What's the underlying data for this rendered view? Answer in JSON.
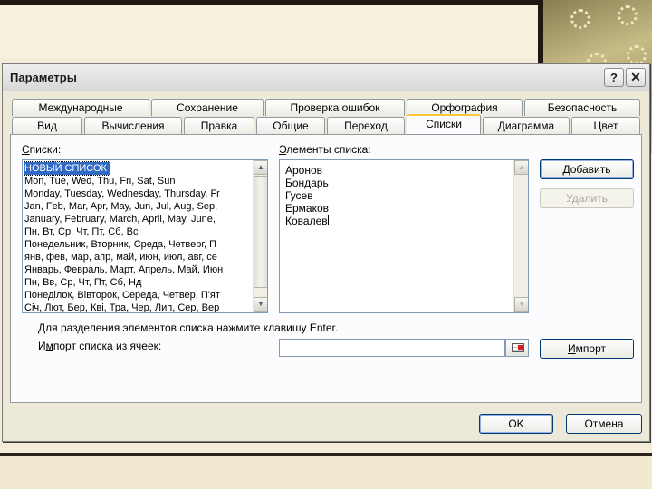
{
  "window": {
    "title": "Параметры",
    "help_glyph": "?",
    "close_glyph": "✕"
  },
  "tabs_row1": [
    "Международные",
    "Сохранение",
    "Проверка ошибок",
    "Орфография",
    "Безопасность"
  ],
  "tabs_row2": [
    "Вид",
    "Вычисления",
    "Правка",
    "Общие",
    "Переход",
    "Списки",
    "Диаграмма",
    "Цвет"
  ],
  "active_tab": "Списки",
  "lists": {
    "label_first": "С",
    "label_rest": "писки:",
    "items": [
      "НОВЫЙ СПИСОК",
      "Mon, Tue, Wed, Thu, Fri, Sat, Sun",
      "Monday, Tuesday, Wednesday, Thursday, Fr",
      "Jan, Feb, Mar, Apr, May, Jun, Jul, Aug, Sep,",
      "January, February, March, April, May, June,",
      "Пн, Вт, Ср, Чт, Пт, Сб, Вс",
      "Понедельник, Вторник, Среда, Четверг, П",
      "янв, фев, мар, апр, май, июн, июл, авг, се",
      "Январь, Февраль, Март, Апрель, Май, Июн",
      "Пн, Вв, Ср, Чт, Пт, Сб, Нд",
      "Понеділок, Вівторок, Середа, Четвер, П'ят",
      "Січ, Лют, Бер, Кві, Тра, Чер, Лип, Сер, Вер"
    ]
  },
  "elements": {
    "label_first": "Э",
    "label_rest": "лементы списка:",
    "items": [
      "Аронов",
      "Бондарь",
      "Гусев",
      "Ермаков",
      "Ковалев"
    ]
  },
  "buttons": {
    "add_first": "Д",
    "add_rest": "обавить",
    "delete": "Удалить",
    "import_first": "И",
    "import_rest": "мпорт",
    "ok": "OK",
    "cancel": "Отмена"
  },
  "hint_text": "Для разделения элементов списка нажмите клавишу Enter.",
  "import_label_pre": "И",
  "import_label_under": "м",
  "import_label_post": "порт списка из ячеек:",
  "import_value": "",
  "scroll": {
    "up_glyph": "▲",
    "down_glyph": "▼"
  }
}
